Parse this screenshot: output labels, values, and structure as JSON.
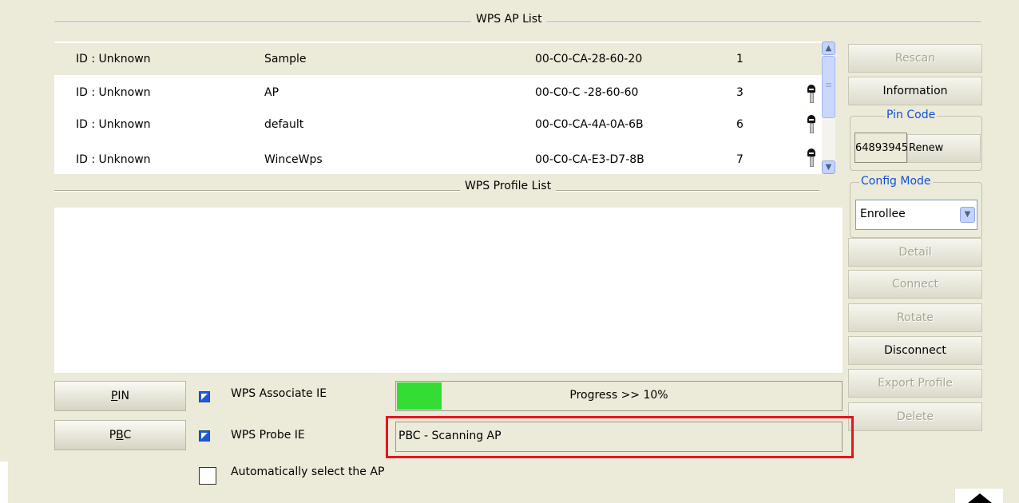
{
  "ap_list": {
    "title": "WPS AP List",
    "rows": [
      {
        "id": "ID : Unknown",
        "name": "Sample",
        "mac": "00-C0-CA-28-60-20",
        "channel": "1",
        "locked": false
      },
      {
        "id": "ID : Unknown",
        "name": "AP",
        "mac": "00-C0-C -28-60-60",
        "channel": "3",
        "locked": true
      },
      {
        "id": "ID : Unknown",
        "name": "default",
        "mac": "00-C0-CA-4A-0A-6B",
        "channel": "6",
        "locked": true
      },
      {
        "id": "ID : Unknown",
        "name": "WinceWps",
        "mac": "00-C0-CA-E3-D7-8B",
        "channel": "7",
        "locked": true
      }
    ]
  },
  "profile_list": {
    "title": "WPS Profile List"
  },
  "right_panel": {
    "rescan": "Rescan",
    "information": "Information",
    "pin_code_label": "Pin Code",
    "pin_code_value": "64893945",
    "renew": "Renew",
    "config_mode_label": "Config Mode",
    "config_mode_value": "Enrollee",
    "detail": "Detail",
    "connect": "Connect",
    "rotate": "Rotate",
    "disconnect": "Disconnect",
    "export_profile": "Export Profile",
    "delete": "Delete"
  },
  "bottom": {
    "pin_button": "PIN",
    "pbc_button": "PBC",
    "wps_associate_ie": "WPS Associate IE",
    "wps_probe_ie": "WPS Probe IE",
    "auto_select": "Automatically select the AP",
    "progress_text": "Progress >> 10%",
    "progress_value": 0.1,
    "status_text": "PBC - Scanning AP"
  },
  "colors": {
    "progress_fill": "#33dd33",
    "highlight_box": "#e8141c",
    "legend_text": "#1050d8"
  },
  "icons": [
    "key-icon",
    "scroll-up-icon",
    "scroll-down-icon",
    "dropdown-arrow-icon",
    "checkbox-checked-icon",
    "checkbox-unchecked-icon"
  ]
}
